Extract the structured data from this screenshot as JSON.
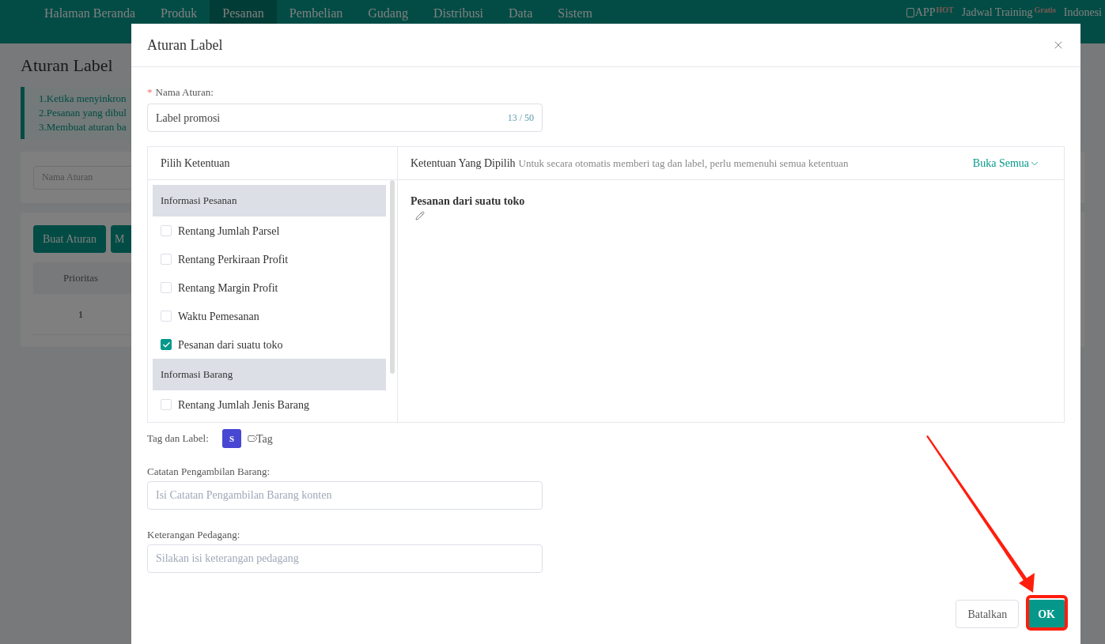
{
  "nav": {
    "items": [
      {
        "label": "Halaman Beranda",
        "selected": false
      },
      {
        "label": "Produk",
        "selected": false
      },
      {
        "label": "Pesanan",
        "selected": true
      },
      {
        "label": "Pembelian",
        "selected": false
      },
      {
        "label": "Gudang",
        "selected": false
      },
      {
        "label": "Distribusi",
        "selected": false
      },
      {
        "label": "Data",
        "selected": false
      },
      {
        "label": "Sistem",
        "selected": false
      }
    ],
    "app": {
      "label": "APP",
      "badge": "HOT"
    },
    "training": {
      "label": "Jadwal Training",
      "badge": "Gratis"
    },
    "language": "Indonesi"
  },
  "page": {
    "title": "Aturan Label",
    "notes": [
      "1.Ketika menyinkron",
      "2.Pesanan yang dibul",
      "3.Membuat aturan ba"
    ],
    "search_placeholder": "Nama Aturan",
    "buttons": [
      "Buat Aturan",
      "M"
    ],
    "table": {
      "columns": [
        "Prioritas"
      ],
      "rows": [
        [
          "1"
        ]
      ]
    }
  },
  "dialog": {
    "title": "Aturan Label",
    "name_field": {
      "label": "Nama Aturan:",
      "required_mark": "*",
      "value": "Label promosi",
      "counter": "13 / 50"
    },
    "conditions": {
      "title": "Pilih Ketentuan",
      "groups": [
        {
          "title": "Informasi Pesanan",
          "items": [
            {
              "label": "Rentang Jumlah Parsel",
              "checked": false
            },
            {
              "label": "Rentang Perkiraan Profit",
              "checked": false
            },
            {
              "label": "Rentang Margin Profit",
              "checked": false
            },
            {
              "label": "Waktu Pemesanan",
              "checked": false
            },
            {
              "label": "Pesanan dari suatu toko",
              "checked": true
            }
          ]
        },
        {
          "title": "Informasi Barang",
          "items": [
            {
              "label": "Rentang Jumlah Jenis Barang",
              "checked": false
            }
          ]
        }
      ]
    },
    "selected_conditions": {
      "title": "Ketentuan Yang Dipilih",
      "hint": "Untuk secara otomatis memberi tag dan label, perlu memenuhi semua ketentuan",
      "expand_link": "Buka Semua",
      "items": [
        "Pesanan dari suatu toko"
      ]
    },
    "tags": {
      "label": "Tag dan Label:",
      "badge": "S",
      "add": "Tag"
    },
    "picking_note": {
      "label": "Catatan Pengambilan Barang:",
      "placeholder": "Isi Catatan Pengambilan Barang konten"
    },
    "merchant_note": {
      "label": "Keterangan Pedagang:",
      "placeholder": "Silakan isi keterangan pedagang"
    },
    "buttons": {
      "cancel": "Batalkan",
      "ok": "OK"
    }
  }
}
